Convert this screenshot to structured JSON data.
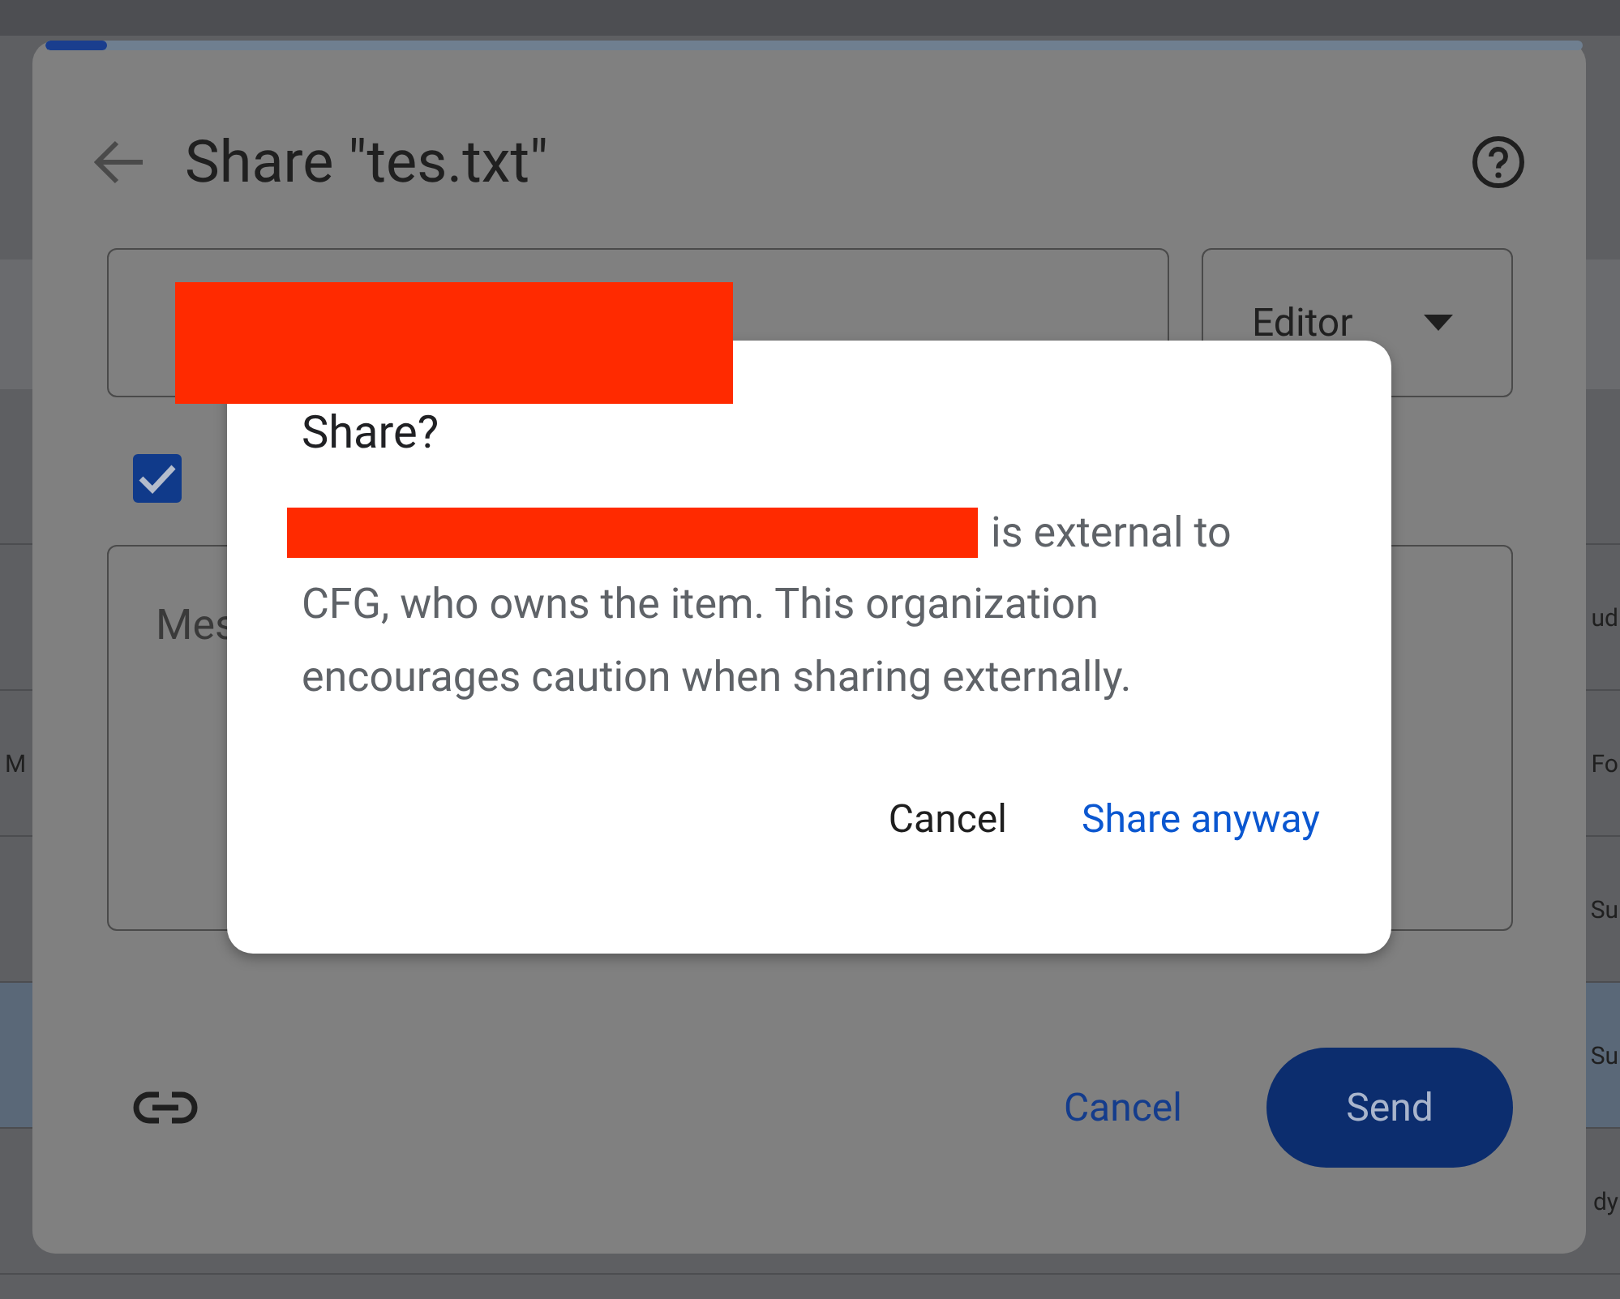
{
  "background": {
    "rows": [
      {
        "right": "ud",
        "selected": false
      },
      {
        "left": "M",
        "right": "Fo",
        "selected": false
      },
      {
        "right": "Su",
        "selected": false
      },
      {
        "right": "Su",
        "selected": true
      },
      {
        "right": "dy",
        "selected": false
      }
    ]
  },
  "share_dialog": {
    "progress": {
      "level": 0.04
    },
    "title": "Share \"tes.txt\"",
    "role": "Editor",
    "notify": {
      "checked": true
    },
    "message_placeholder": "Mes",
    "cancel": "Cancel",
    "send": "Send"
  },
  "confirm_dialog": {
    "title": "Share?",
    "message_lead": "is external to",
    "message": "CFG, who owns the item. This organization encourages caution when sharing externally.",
    "buttons": [
      {
        "label": "Cancel",
        "kind": "secondary"
      },
      {
        "label": "Share anyway",
        "kind": "primary"
      }
    ]
  }
}
